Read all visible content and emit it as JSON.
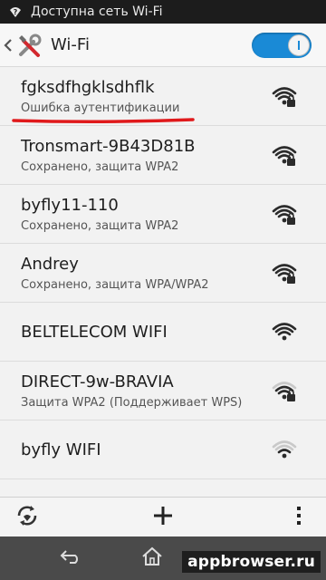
{
  "status_bar": {
    "notification_text": "Доступна сеть Wi-Fi",
    "icon": "wifi-question-icon"
  },
  "action_bar": {
    "title": "Wi-Fi",
    "back_icon": "chevron-left-icon",
    "app_icon": "settings-tools-icon",
    "wifi_toggle_on": true
  },
  "networks": [
    {
      "name": "fgksdfhgklsdhflk",
      "status": "Ошибка аутентификации",
      "secured": true,
      "signal": "full",
      "highlighted": true
    },
    {
      "name": "Tronsmart-9B43D81B",
      "status": "Сохранено, защита WPA2",
      "secured": true,
      "signal": "full"
    },
    {
      "name": "byfly11-110",
      "status": "Сохранено, защита WPA2",
      "secured": true,
      "signal": "full"
    },
    {
      "name": "Andrey",
      "status": "Сохранено, защита WPA/WPA2",
      "secured": true,
      "signal": "full"
    },
    {
      "name": "BELTELECOM WIFI",
      "status": "",
      "secured": false,
      "signal": "full"
    },
    {
      "name": "DIRECT-9w-BRAVIA",
      "status": "Защита WPA2 (Поддерживает WPS)",
      "secured": true,
      "signal": "medium"
    },
    {
      "name": "byfly WIFI",
      "status": "",
      "secured": false,
      "signal": "low"
    }
  ],
  "bottom_actions": {
    "refresh_icon": "refresh-wifi-icon",
    "add_icon": "plus-icon",
    "menu_icon": "overflow-menu-icon"
  },
  "nav_bar": {
    "back_icon": "nav-back-icon",
    "home_icon": "nav-home-icon"
  },
  "watermark": "appbrowser.ru",
  "colors": {
    "accent": "#1a8ad6",
    "highlight_underline": "#e0191b",
    "status_bar": "#1c1c1c",
    "nav_bar": "#4a4a4a"
  }
}
